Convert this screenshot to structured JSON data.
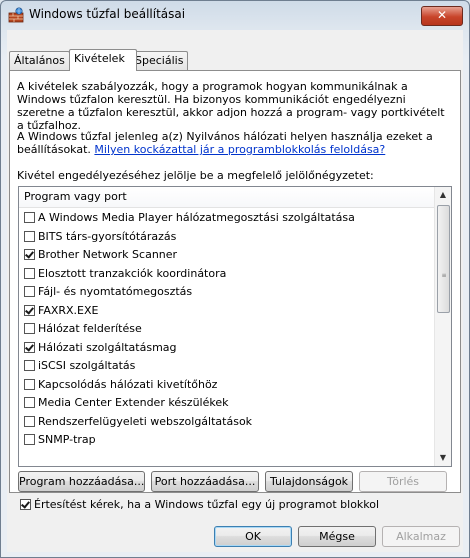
{
  "window": {
    "title": "Windows tűzfal beállításai",
    "close_glyph": "✕"
  },
  "tabs": [
    {
      "label": "Általános"
    },
    {
      "label": "Kivételek"
    },
    {
      "label": "Speciális"
    }
  ],
  "panel": {
    "intro": "A kivételek szabályozzák, hogy a programok hogyan kommunikálnak a Windows tűzfalon keresztül. Ha bizonyos kommunikációt engedélyezni szeretne a tűzfalon keresztül, akkor adjon hozzá a program- vagy portkivételt a tűzfalhoz.",
    "profile_text": "A Windows tűzfal jelenleg a(z) Nyilvános hálózati helyen használja ezeket a beállításokat.",
    "risk_link": "Milyen kockázattal jár a programblokkolás feloldása?",
    "list_caption": "Kivétel engedélyezéséhez jelölje be a megfelelő jelölőnégyzetet:",
    "list_header": "Program vagy port",
    "items": [
      {
        "label": "A Windows Media Player hálózatmegosztási szolgáltatása",
        "checked": false
      },
      {
        "label": "BITS társ-gyorsítótárazás",
        "checked": false
      },
      {
        "label": "Brother Network Scanner",
        "checked": true
      },
      {
        "label": "Elosztott tranzakciók koordinátora",
        "checked": false
      },
      {
        "label": "Fájl- és nyomtatómegosztás",
        "checked": false
      },
      {
        "label": "FAXRX.EXE",
        "checked": true
      },
      {
        "label": "Hálózat felderítése",
        "checked": false
      },
      {
        "label": "Hálózati szolgáltatásmag",
        "checked": true
      },
      {
        "label": "iSCSI szolgáltatás",
        "checked": false
      },
      {
        "label": "Kapcsolódás hálózati kivetítőhöz",
        "checked": false
      },
      {
        "label": "Media Center Extender készülékek",
        "checked": false
      },
      {
        "label": "Rendszerfelügyeleti webszolgáltatások",
        "checked": false
      },
      {
        "label": "SNMP-trap",
        "checked": false
      }
    ],
    "scroll_up": "▲",
    "scroll_down": "▼",
    "scroll_grip": "≡"
  },
  "actions": {
    "add_program": "Program hozzáadása...",
    "add_port": "Port hozzáadása...",
    "properties": "Tulajdonságok",
    "delete": "Törlés"
  },
  "notify": {
    "label": "Értesítést kérek, ha a Windows tűzfal egy új programot blokkol",
    "checked": true
  },
  "footer": {
    "ok": "OK",
    "cancel": "Mégse",
    "apply": "Alkalmaz"
  }
}
